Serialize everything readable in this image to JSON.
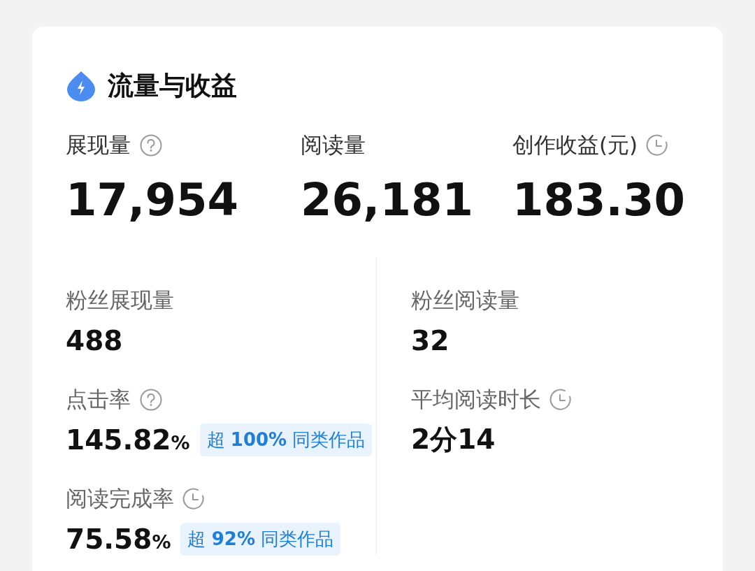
{
  "card": {
    "title": "流量与收益",
    "headline": [
      {
        "kind": "help",
        "label": "展现量",
        "value": "17,954"
      },
      {
        "kind": "plain",
        "label": "阅读量",
        "value": "26,181"
      },
      {
        "kind": "timed",
        "label": "创作收益(元)",
        "value": "183.30"
      }
    ],
    "left_column": [
      {
        "kind": "plain",
        "label": "粉丝展现量",
        "value": "488"
      },
      {
        "kind": "help",
        "label": "点击率",
        "value": "145.82",
        "unit": "%",
        "badge": "超 **100%** 同类作品"
      },
      {
        "kind": "timed",
        "label": "阅读完成率",
        "value": "75.58",
        "unit": "%",
        "badge": "超 **92%** 同类作品"
      }
    ],
    "right_column": [
      {
        "kind": "plain",
        "label": "粉丝阅读量",
        "value": "32"
      },
      {
        "kind": "timed",
        "label": "平均阅读时长",
        "value": "2分14"
      }
    ]
  }
}
